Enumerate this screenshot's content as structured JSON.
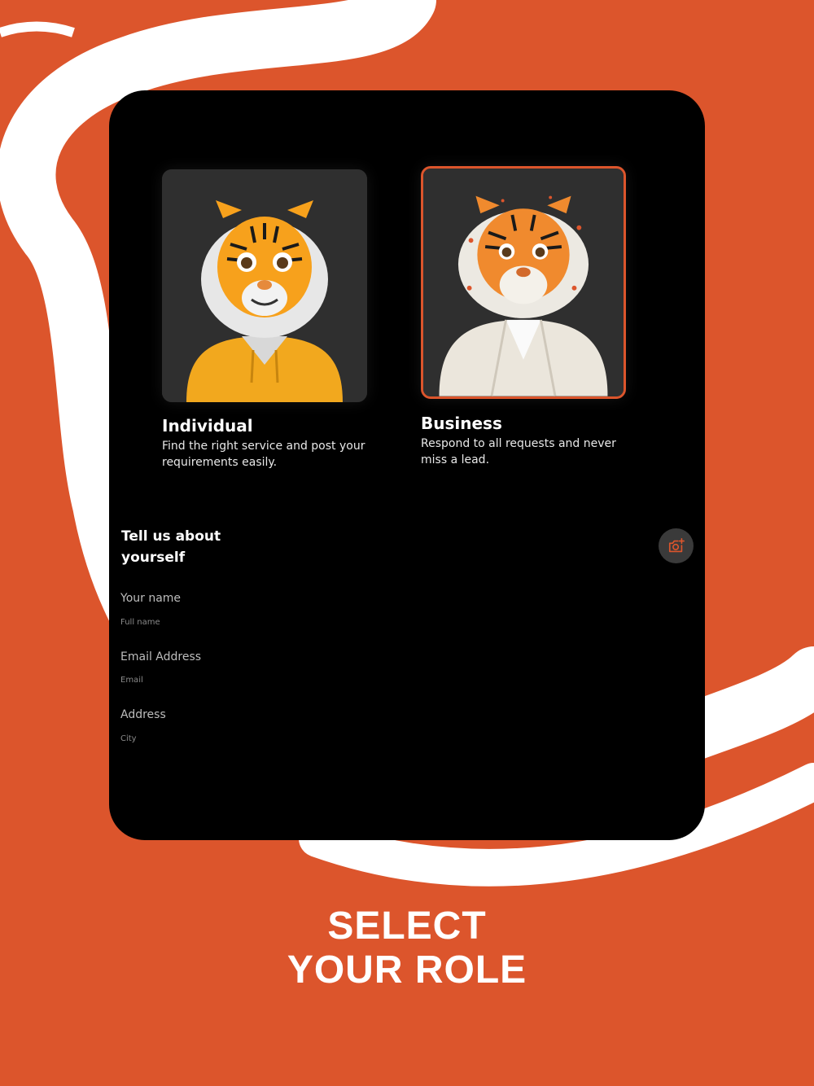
{
  "roles": [
    {
      "title": "Individual",
      "description": "Find the right service and post your requirements easily.",
      "avatar_icon": "tiger-hoodie-avatar"
    },
    {
      "title": "Business",
      "description": "Respond to all requests and never miss a lead.",
      "avatar_icon": "tiger-suit-avatar",
      "selected": true
    }
  ],
  "form": {
    "title": "Tell us about yourself",
    "camera_icon": "camera-add-icon",
    "fields": [
      {
        "label": "Your name",
        "placeholder": "Full name"
      },
      {
        "label": "Email Address",
        "placeholder": "Email"
      },
      {
        "label": "Address",
        "placeholder": "City"
      }
    ]
  },
  "headline": {
    "line1": "SELECT",
    "line2": "YOUR ROLE"
  },
  "colors": {
    "accent": "#DC552C",
    "device_bg": "#000000",
    "card_bg": "#2F2F2F",
    "swirl": "#FFFFFF"
  }
}
